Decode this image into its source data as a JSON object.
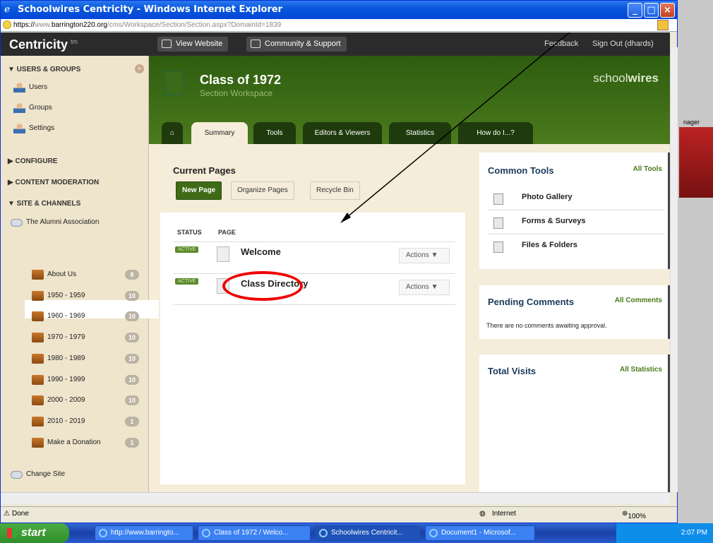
{
  "window": {
    "title": "Schoolwires Centricity - Windows Internet Explorer",
    "url_prefix": "https://",
    "url_gray": "www.",
    "url_domain": "barrington220.org",
    "url_path": "/cms/Workspace/Section/Section.aspx?DomainId=1839"
  },
  "topbar": {
    "logo": "Centricity",
    "logo_sup": "tm",
    "view_website": "View Website",
    "community": "Community & Support",
    "feedback": "Feedback",
    "signout": "Sign Out (dhards)"
  },
  "sidebar": {
    "users_groups": "▼ USERS & GROUPS",
    "users": "Users",
    "groups": "Groups",
    "settings": "Settings",
    "configure": "▶ CONFIGURE",
    "content_moderation": "▶ CONTENT MODERATION",
    "sites_channels": "▼ SITE & CHANNELS",
    "alumni": "The Alumni Association",
    "sections": [
      {
        "label": "About Us",
        "count": "8"
      },
      {
        "label": "1950 - 1959",
        "count": "10"
      },
      {
        "label": "1960 - 1969",
        "count": "10"
      },
      {
        "label": "1970 - 1979",
        "count": "10"
      },
      {
        "label": "1980 - 1989",
        "count": "10"
      },
      {
        "label": "1990 - 1999",
        "count": "10"
      },
      {
        "label": "2000 - 2009",
        "count": "10"
      },
      {
        "label": "2010 - 2019",
        "count": "1"
      },
      {
        "label": "Make a Donation",
        "count": "1"
      }
    ],
    "change_site": "Change Site"
  },
  "header": {
    "title": "Class of 1972",
    "subtitle": "Section Workspace",
    "brand_a": "school",
    "brand_b": "wires"
  },
  "tabs": {
    "summary": "Summary",
    "tools": "Tools",
    "editors": "Editors & Viewers",
    "statistics": "Statistics",
    "howdo": "How do I...?"
  },
  "current_pages": {
    "heading": "Current Pages",
    "new_page": "New Page",
    "organize": "Organize Pages",
    "recycle": "Recycle Bin",
    "col_status": "STATUS",
    "col_page": "PAGE",
    "rows": [
      {
        "status": "ACTIVE",
        "title": "Welcome",
        "actions": "Actions ▼"
      },
      {
        "status": "ACTIVE",
        "title": "Class Directory",
        "actions": "Actions ▼"
      }
    ]
  },
  "common_tools": {
    "heading": "Common Tools",
    "all": "All Tools",
    "items": [
      "Photo Gallery",
      "Forms & Surveys",
      "Files & Folders"
    ]
  },
  "pending": {
    "heading": "Pending Comments",
    "all": "All Comments",
    "empty": "There are no comments awaiting approval."
  },
  "visits": {
    "heading": "Total Visits",
    "all": "All Statistics"
  },
  "statusbar": {
    "done": "Done",
    "zone": "Internet",
    "zoom": "100%"
  },
  "taskbar": {
    "start": "start",
    "tasks": [
      "http://www.barringto...",
      "Class of 1972 / Welco...",
      "Schoolwires Centricit...",
      "Document1 - Microsof..."
    ],
    "time": "2:07 PM"
  },
  "behind": {
    "label": "nager"
  }
}
